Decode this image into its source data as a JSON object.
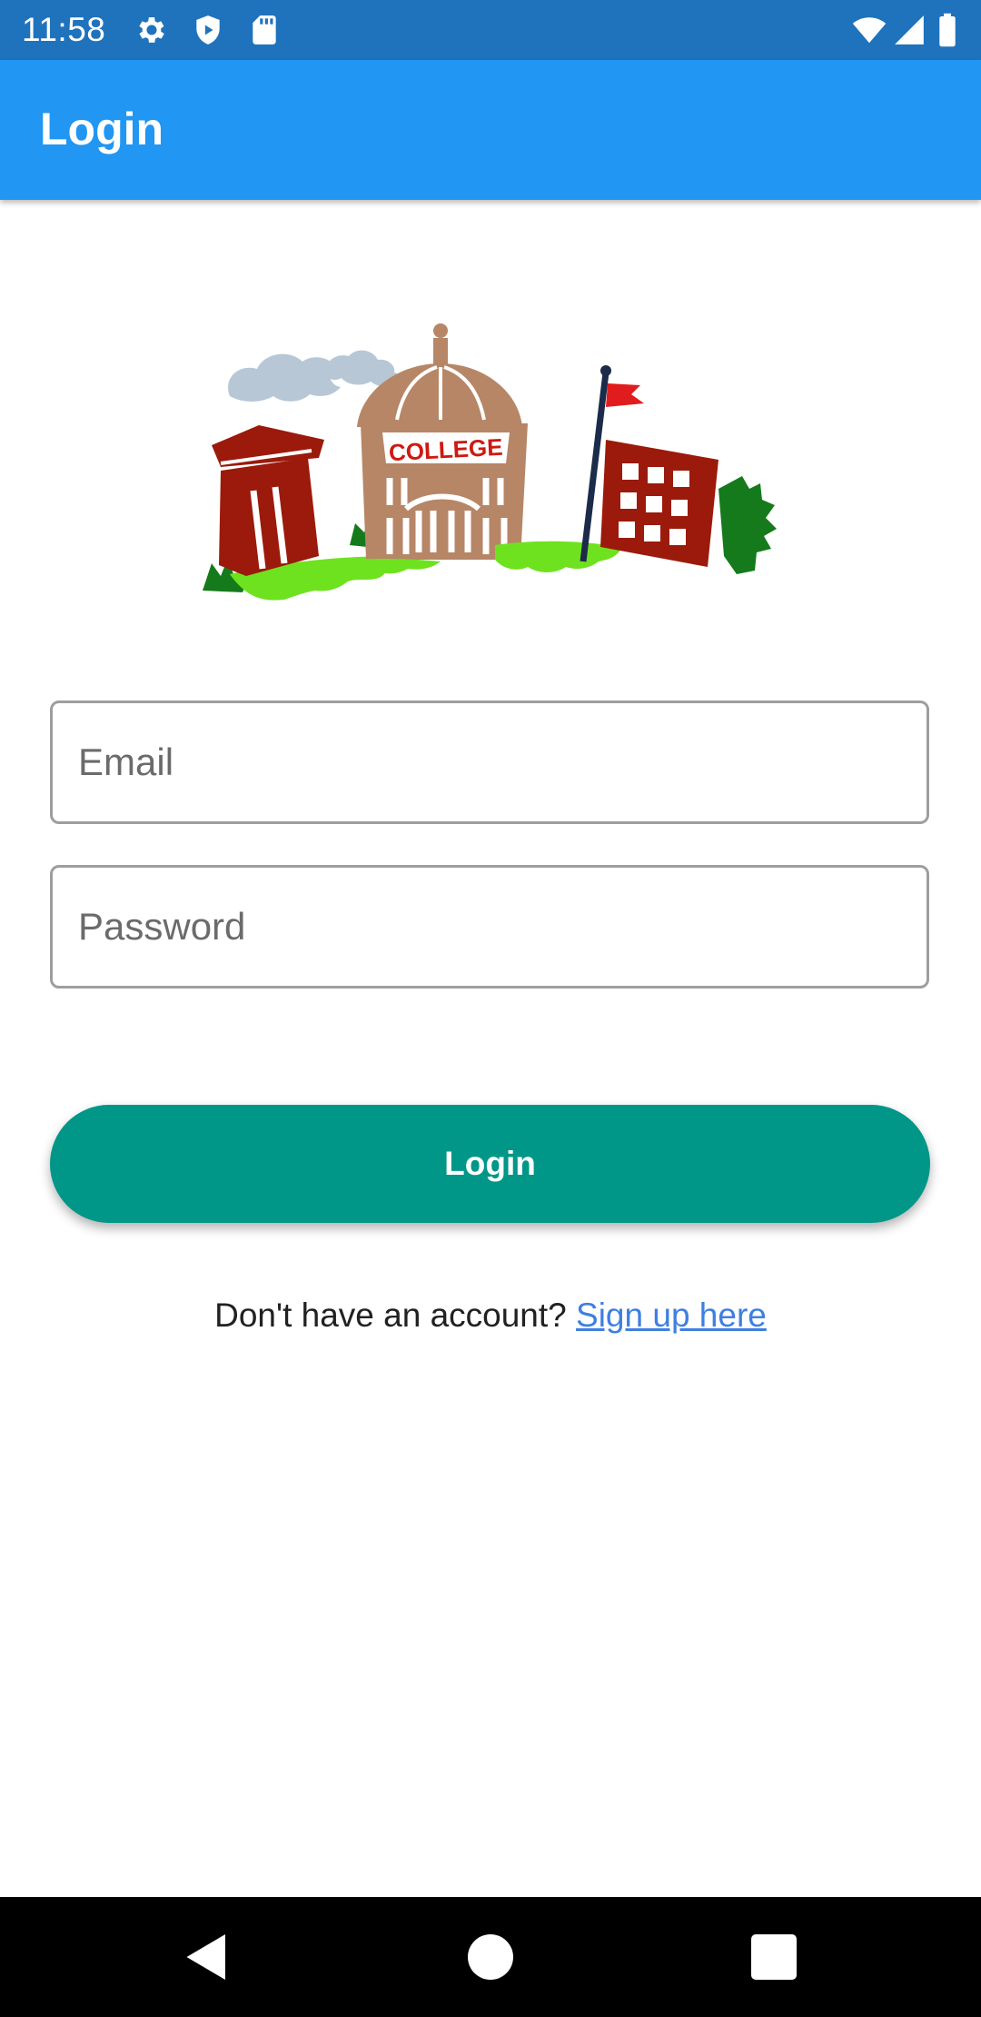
{
  "status_bar": {
    "time": "11:58",
    "left_icons": [
      "gear-icon",
      "shield-icon",
      "sd-card-icon"
    ],
    "right_icons": [
      "wifi-icon",
      "signal-icon",
      "battery-icon"
    ],
    "background": "#1f73bd"
  },
  "app_bar": {
    "title": "Login",
    "background": "#2196f3"
  },
  "logo": {
    "sign_text": "COLLEGE"
  },
  "form": {
    "email_placeholder": "Email",
    "password_placeholder": "Password",
    "login_label": "Login",
    "button_color": "#009688"
  },
  "signup": {
    "prompt": "Don't have an account?",
    "link_label": "Sign up here",
    "link_color": "#3f7fe0"
  },
  "nav_bar": {
    "buttons": [
      "back-icon",
      "home-icon",
      "recents-icon"
    ]
  }
}
